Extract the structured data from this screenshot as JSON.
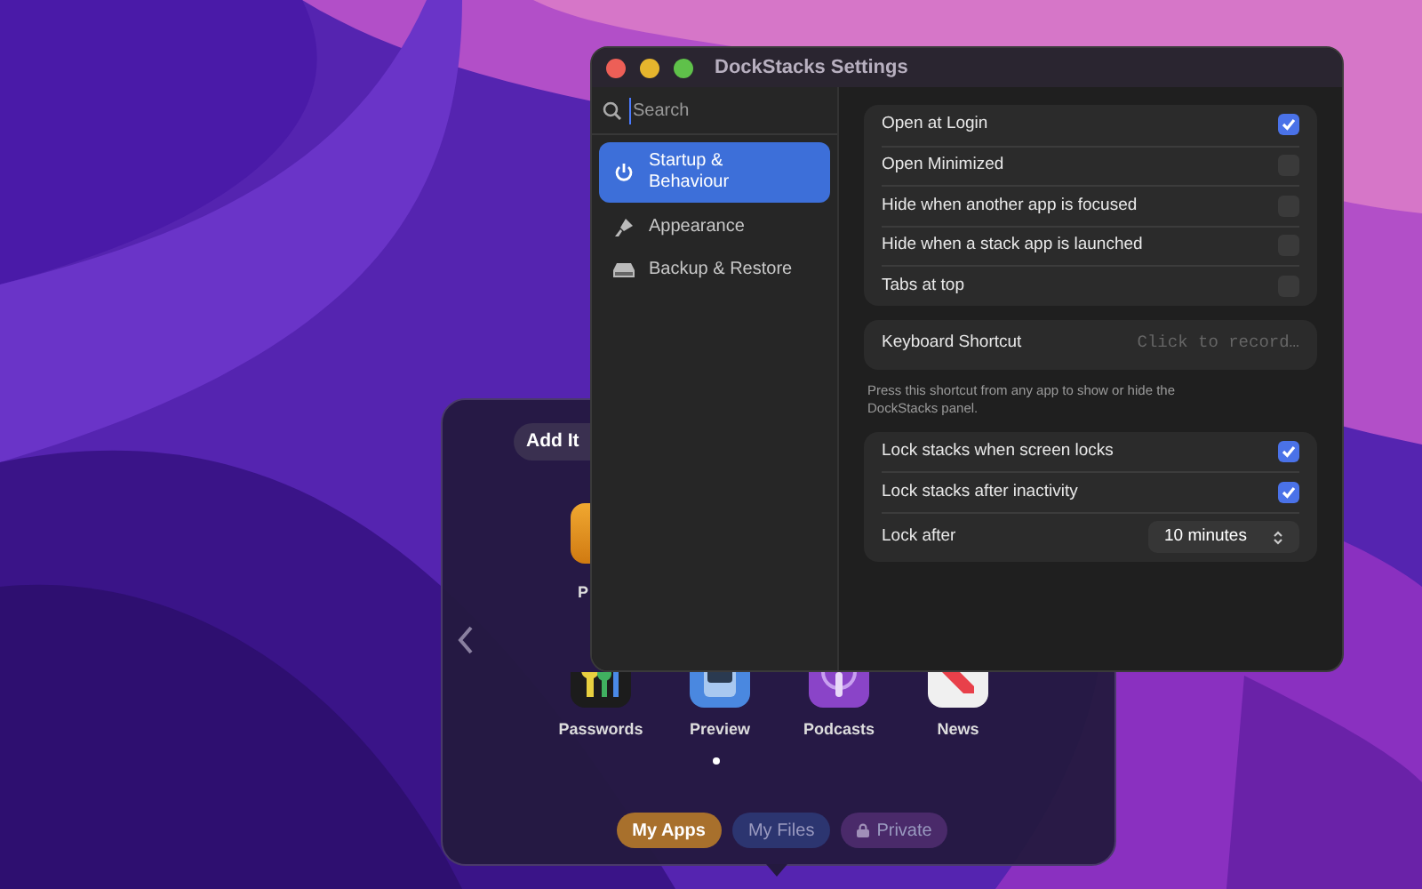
{
  "stack_panel": {
    "add_button": "Add It",
    "top_apps": [
      {
        "label": "P"
      }
    ],
    "apps": [
      {
        "label": "Passwords"
      },
      {
        "label": "Preview"
      },
      {
        "label": "Podcasts"
      },
      {
        "label": "News"
      }
    ],
    "pages": [
      {
        "selected": true
      }
    ],
    "tabs": [
      {
        "label": "My Apps",
        "selected": true,
        "color": "#a8702c",
        "locked": false
      },
      {
        "label": "My Files",
        "selected": false,
        "color": "#2c3570",
        "locked": false
      },
      {
        "label": "Private",
        "selected": false,
        "color": "#4a2a6a",
        "locked": true
      }
    ]
  },
  "window": {
    "title": "DockStacks Settings"
  },
  "sidebar": {
    "search": {
      "placeholder": "Search"
    },
    "items": [
      {
        "label": "Startup & Behaviour",
        "selected": true
      },
      {
        "label": "Appearance",
        "selected": false
      },
      {
        "label": "Backup & Restore",
        "selected": false
      }
    ]
  },
  "general": [
    {
      "label": "Open at Login",
      "checked": true
    },
    {
      "label": "Open Minimized",
      "checked": false
    },
    {
      "label": "Hide when another app is focused",
      "checked": false
    },
    {
      "label": "Hide when a stack app is launched",
      "checked": false
    },
    {
      "label": "Tabs at top",
      "checked": false
    }
  ],
  "shortcut": {
    "label": "Keyboard Shortcut",
    "placeholder": "Click to record…",
    "hint": "Press this shortcut from any app to show or hide the DockStacks panel."
  },
  "lock": [
    {
      "kind": "checkbox",
      "label": "Lock stacks when screen locks",
      "checked": true
    },
    {
      "kind": "checkbox",
      "label": "Lock stacks after inactivity",
      "checked": true
    },
    {
      "kind": "select",
      "label": "Lock after",
      "value": "10 minutes"
    }
  ]
}
